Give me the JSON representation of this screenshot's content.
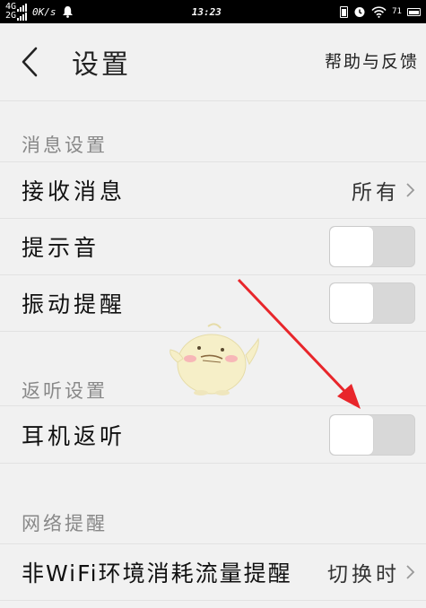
{
  "status_bar": {
    "network_top": "4G",
    "network_bottom": "2G",
    "speed": "0K/s",
    "time": "13:23",
    "signal_label": "71"
  },
  "header": {
    "title": "设置",
    "help_label": "帮助与反馈"
  },
  "sections": {
    "message": {
      "title": "消息设置",
      "receive_label": "接收消息",
      "receive_value": "所有",
      "sound_label": "提示音",
      "sound_on": false,
      "vibrate_label": "振动提醒",
      "vibrate_on": false
    },
    "monitor": {
      "title": "返听设置",
      "earphone_label": "耳机返听",
      "earphone_on": false
    },
    "network": {
      "title": "网络提醒",
      "nonwifi_label": "非WiFi环境消耗流量提醒",
      "nonwifi_value": "切换时"
    }
  },
  "colors": {
    "background": "#f1f1f1",
    "divider": "#e2e2e2",
    "toggle_off": "#d8d8d8",
    "arrow": "#e8262b",
    "mascot_body": "#f6efc8"
  },
  "icons": [
    "back-chevron-icon",
    "chevron-right-icon",
    "bell-icon",
    "alarm-icon",
    "wifi-icon",
    "battery-icon",
    "mascot-illustration"
  ]
}
